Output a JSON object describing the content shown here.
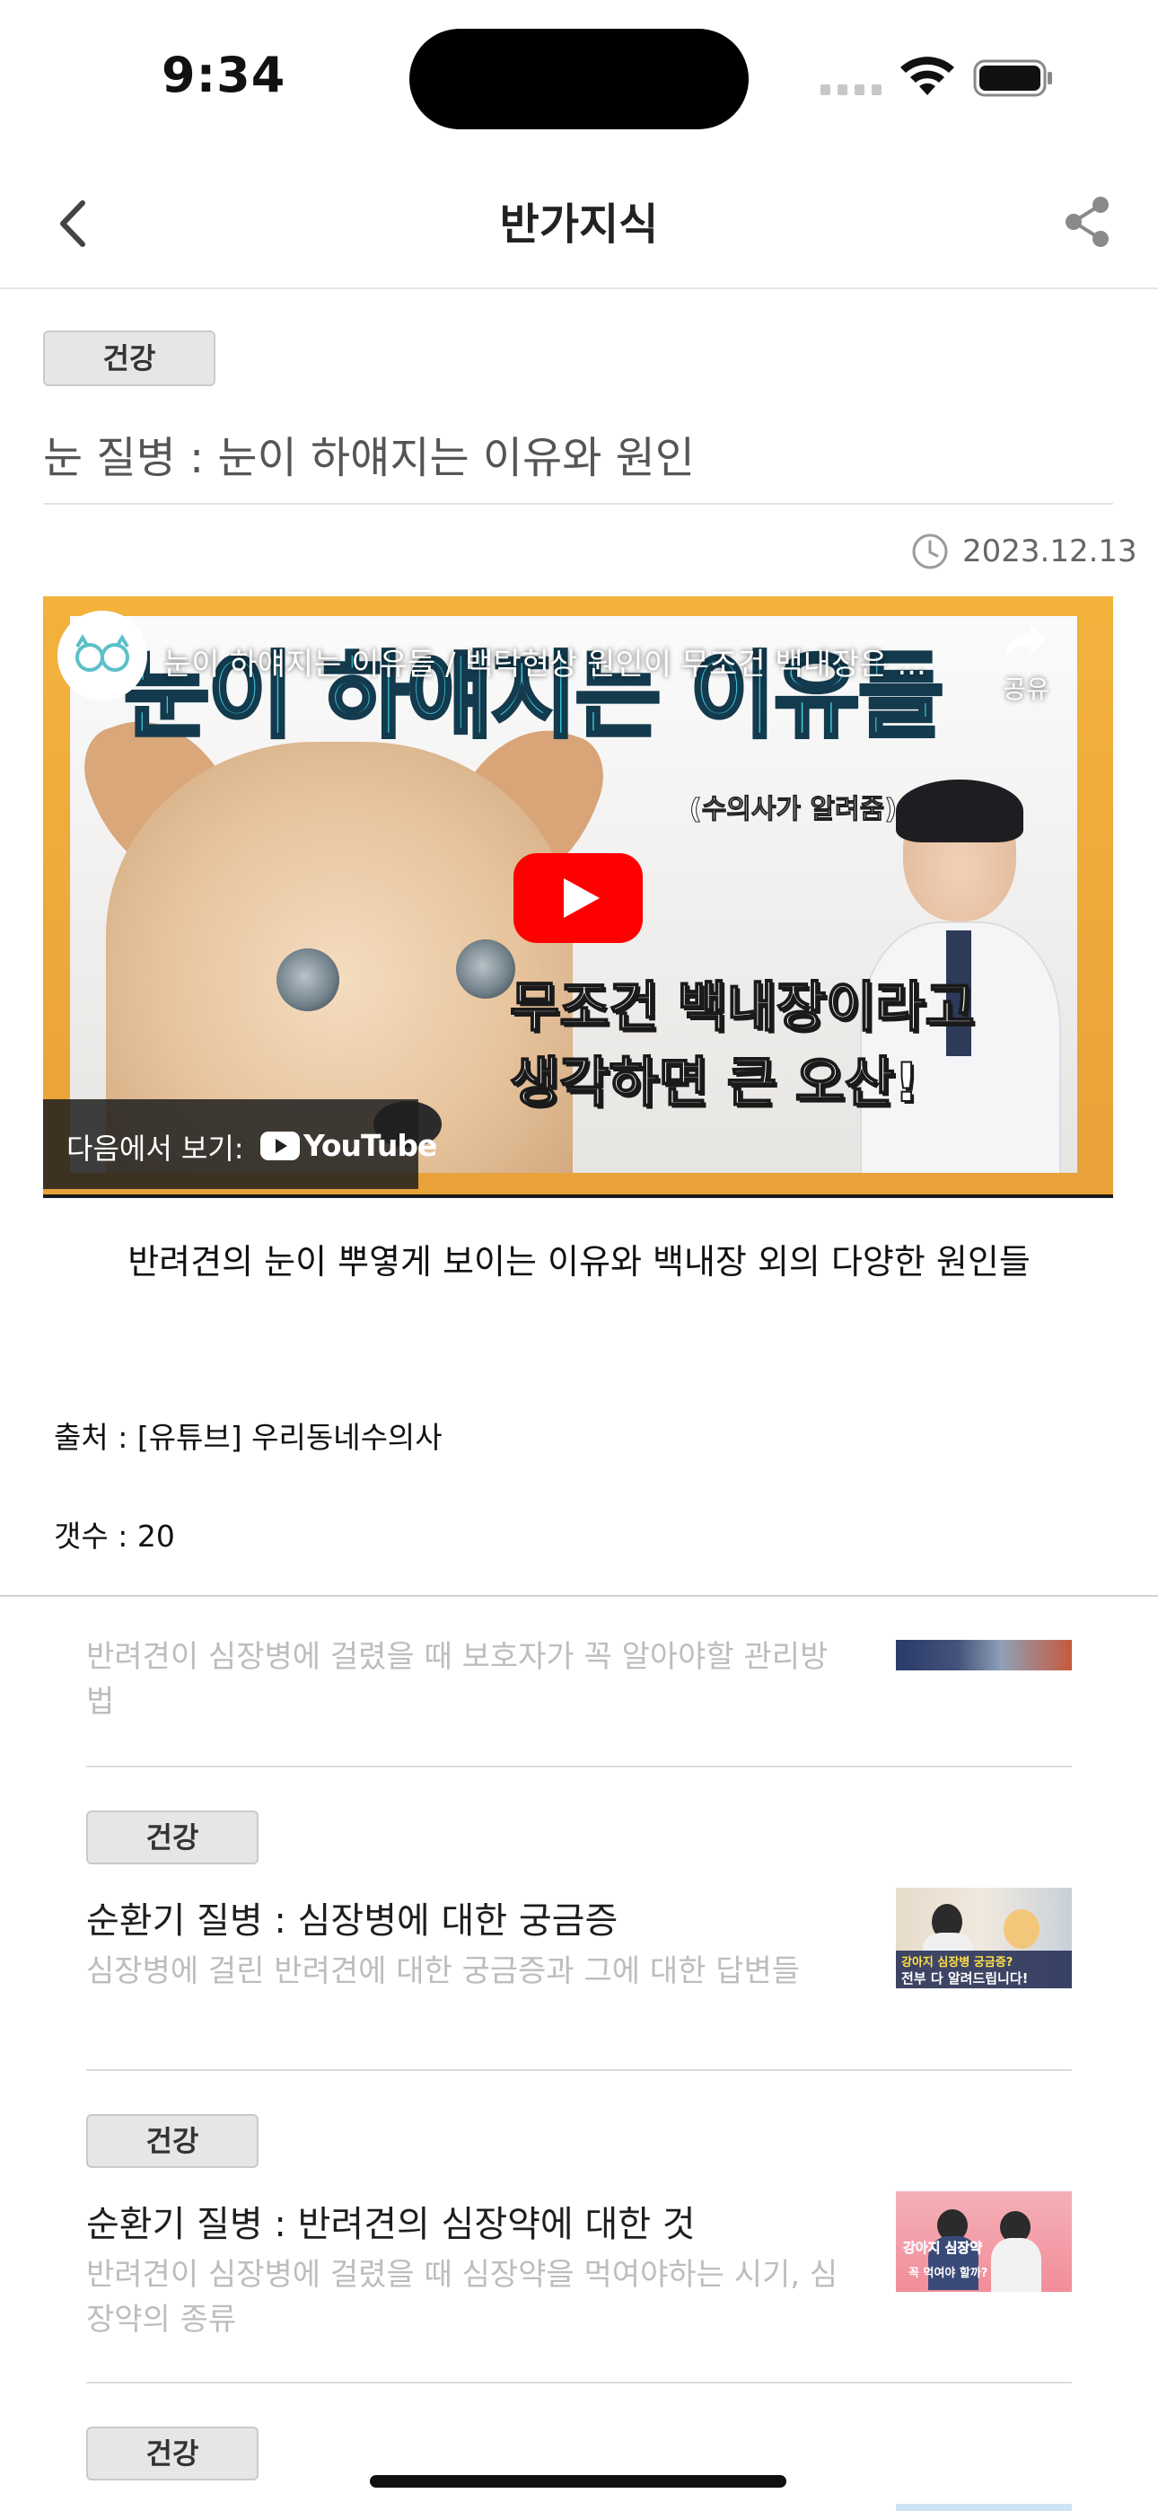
{
  "status_bar": {
    "time": "9:34"
  },
  "header": {
    "title": "반가지식"
  },
  "article": {
    "tag": "건강",
    "title": "눈 질병 : 눈이 하얘지는 이유와 원인",
    "date": "2023.12.13",
    "video": {
      "title": "눈이 하얘지는 이유들 / 백탁현상 원인이 무조건 백내장은 ...",
      "share_label": "공유",
      "thumbnail_headline": "눈이 하얘지는 이유들",
      "thumbnail_sub": "(수의사가 알려줌)",
      "thumbnail_caption_line1": "무조건 백내장이라고",
      "thumbnail_caption_line2": "생각하면 큰 오산!",
      "watch_on_label": "다음에서 보기:",
      "youtube_label": "YouTube"
    },
    "summary": "반려견의 눈이 뿌옇게 보이는 이유와 백내장 외의 다양한 원인들",
    "source": "출처 : [유튜브] 우리동네수의사",
    "count": "갯수 : 20"
  },
  "related": [
    {
      "tag": "",
      "title": "",
      "desc": "반려견이 심장병에 걸렸을 때 보호자가 꼭 알아야할 관리방법"
    },
    {
      "tag": "건강",
      "title": "순환기 질병 : 심장병에 대한 궁금증",
      "desc": "심장병에 걸린 반려견에 대한 궁금증과 그에 대한 답변들",
      "thumb_text_line1": "강아지 심장병 궁금증?",
      "thumb_text_line2": "전부 다 알려드립니다!"
    },
    {
      "tag": "건강",
      "title": "순환기 질병 : 반려견의 심장약에 대한 것",
      "desc": "반려견이 심장병에 걸렸을 때 심장약을 먹여야하는 시기, 심장약의 종류",
      "thumb_text_line1": "강아지 심장약",
      "thumb_text_line2": "꼭 먹여야 할까?"
    },
    {
      "tag": "건강"
    }
  ],
  "colors": {
    "accent_orange": "#f3b23c",
    "youtube_red": "#ff0000",
    "tag_bg": "#e5e6e8",
    "muted_text": "#bdbdbd"
  }
}
